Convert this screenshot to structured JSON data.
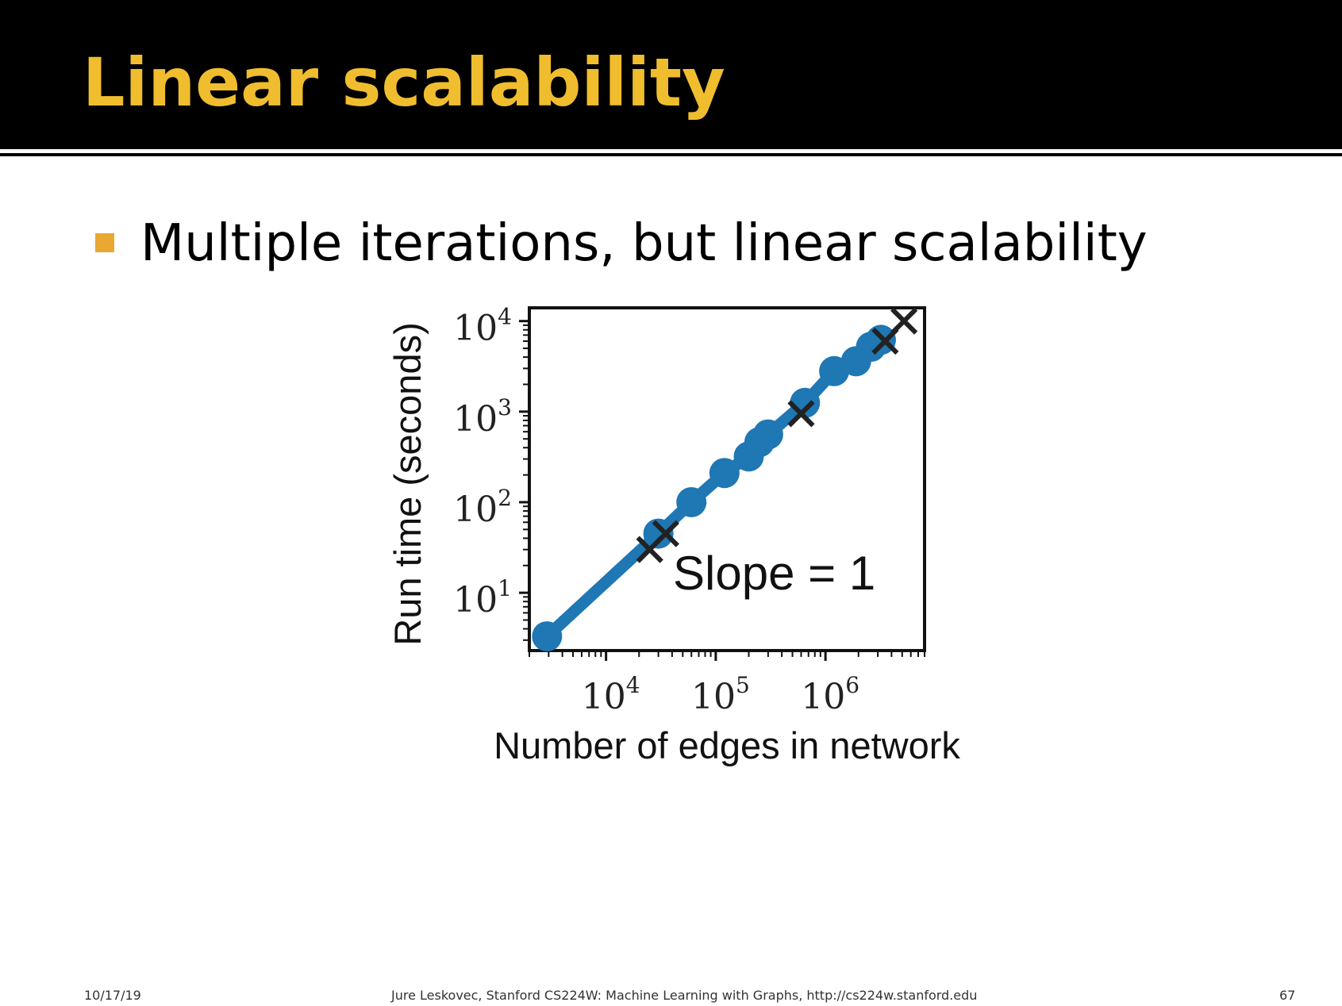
{
  "slide": {
    "title": "Linear scalability",
    "bullet": "Multiple iterations, but linear scalability"
  },
  "footer": {
    "date": "10/17/19",
    "credit": "Jure Leskovec, Stanford CS224W: Machine Learning with Graphs, http://cs224w.stanford.edu",
    "page": "67"
  },
  "colors": {
    "header_bg": "#000000",
    "title": "#f0bd2e",
    "bullet": "#e9a832",
    "series": "#1f77b4",
    "marker": "#222222"
  },
  "chart_data": {
    "type": "line",
    "xlabel": "Number of edges in network",
    "ylabel": "Run time (seconds)",
    "xscale": "log",
    "yscale": "log",
    "xlim": [
      2000,
      8000000
    ],
    "ylim": [
      2.3,
      14000
    ],
    "xticks": [
      10000,
      100000,
      1000000
    ],
    "xtick_labels": [
      {
        "base": "10",
        "exp": "4"
      },
      {
        "base": "10",
        "exp": "5"
      },
      {
        "base": "10",
        "exp": "6"
      }
    ],
    "yticks": [
      10,
      100,
      1000,
      10000
    ],
    "ytick_labels": [
      {
        "base": "10",
        "exp": "1"
      },
      {
        "base": "10",
        "exp": "2"
      },
      {
        "base": "10",
        "exp": "3"
      },
      {
        "base": "10",
        "exp": "4"
      }
    ],
    "grid": false,
    "annotation": "Slope = 1",
    "series": [
      {
        "marker": "circle",
        "x": [
          2900,
          30000,
          60000,
          120000,
          200000,
          250000,
          300000,
          650000,
          1200000,
          1900000,
          2600000,
          3200000
        ],
        "y": [
          3.3,
          45,
          100,
          210,
          320,
          460,
          560,
          1250,
          2800,
          3600,
          5200,
          6200
        ]
      },
      {
        "marker": "x",
        "x": [
          25000,
          35000,
          600000,
          3500000,
          5200000
        ],
        "y": [
          30,
          45,
          950,
          6000,
          10000
        ]
      }
    ]
  }
}
